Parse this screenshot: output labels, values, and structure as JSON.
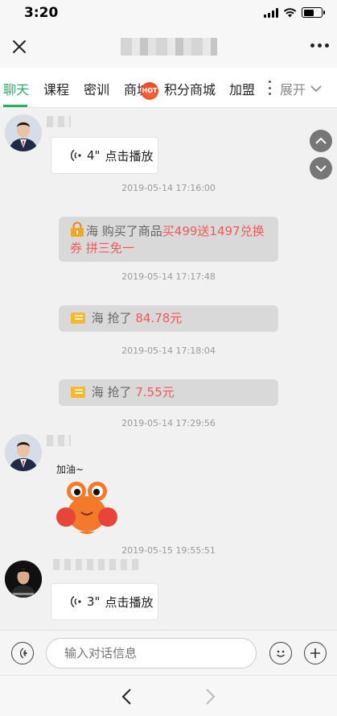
{
  "status_bar": {
    "time": "3:20"
  },
  "tabs": [
    {
      "label": "聊天",
      "active": true
    },
    {
      "label": "课程"
    },
    {
      "label": "密训"
    },
    {
      "label": "商城",
      "badge": "HOT"
    },
    {
      "label": "积分商城"
    },
    {
      "label": "加盟"
    }
  ],
  "expand_label": "展开",
  "messages": {
    "voice1": {
      "duration": "4\"",
      "action": "点击播放"
    },
    "ts1": "2019-05-14 17:16:00",
    "sys1": {
      "prefix": "海 购买了商品",
      "highlight": "买499送1497兑换券 拼三免一"
    },
    "ts2": "2019-05-14 17:17:48",
    "sys2": {
      "prefix": "海 抢了",
      "highlight": "84.78元"
    },
    "ts3": "2019-05-14 17:18:04",
    "sys3": {
      "prefix": "海 抢了",
      "highlight": "7.55元"
    },
    "ts4": "2019-05-14 17:29:56",
    "sticker_text": "加油~",
    "ts5": "2019-05-15 19:55:51",
    "voice2": {
      "duration": "3\"",
      "action": "点击播放"
    }
  },
  "input": {
    "placeholder": "输入对话信息"
  },
  "colors": {
    "accent": "#2aae67",
    "highlight": "#f25a5a",
    "system_bg": "#d9d9d9"
  }
}
